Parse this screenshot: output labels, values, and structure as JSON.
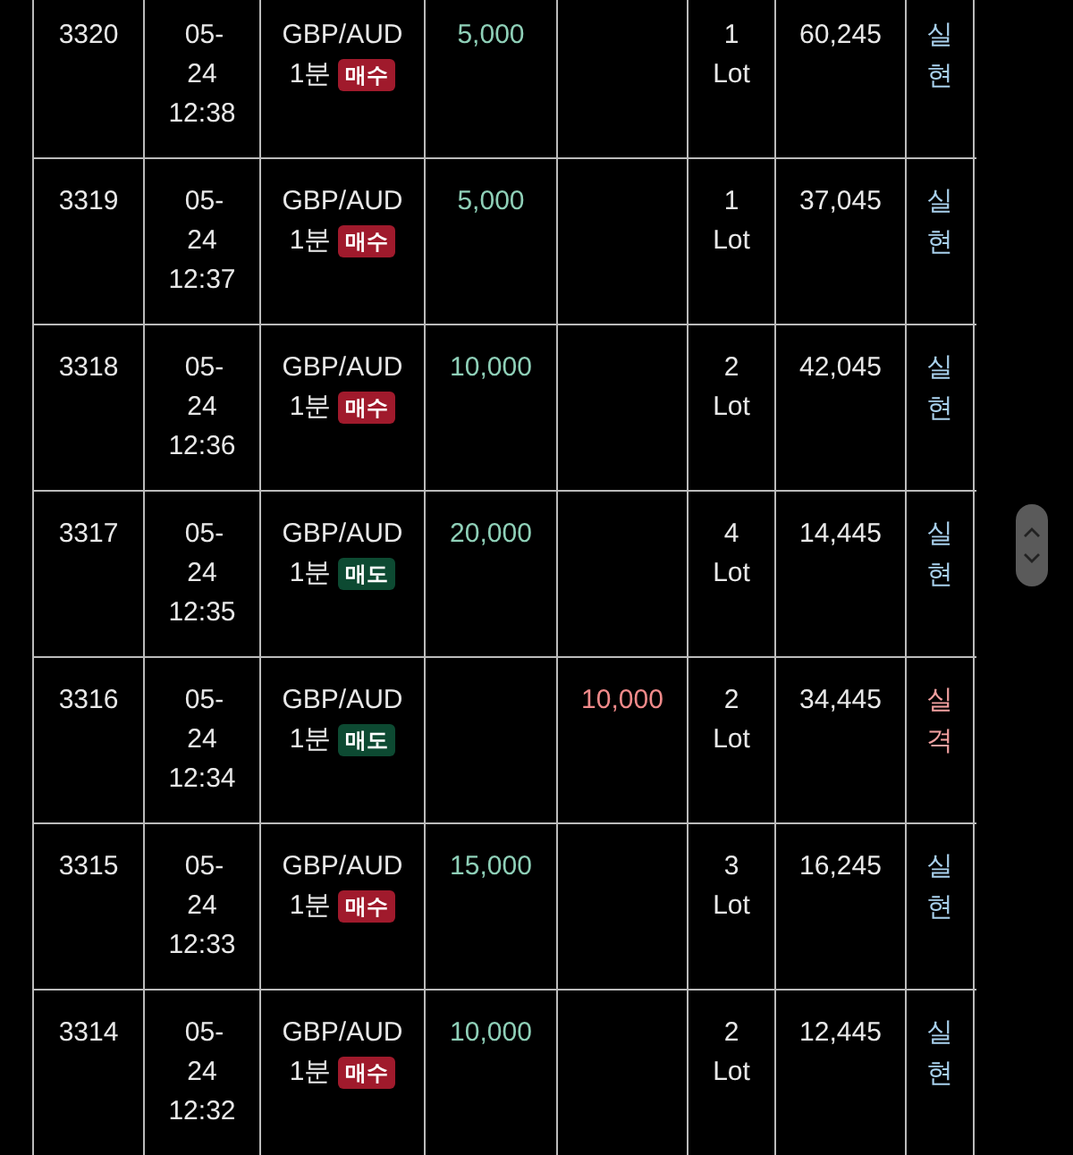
{
  "rows": [
    {
      "id": "3320",
      "date": "05-24",
      "time": "12:38",
      "pair": "GBP/AUD",
      "period": "1분",
      "side": {
        "label": "매수",
        "kind": "buy"
      },
      "profit": "5,000",
      "lot_count": "1",
      "lot_unit": "Lot",
      "balance": "60,245",
      "result": {
        "label": "실현",
        "kind": "realized"
      }
    },
    {
      "id": "3319",
      "date": "05-24",
      "time": "12:37",
      "pair": "GBP/AUD",
      "period": "1분",
      "side": {
        "label": "매수",
        "kind": "buy"
      },
      "profit": "5,000",
      "lot_count": "1",
      "lot_unit": "Lot",
      "balance": "37,045",
      "result": {
        "label": "실현",
        "kind": "realized"
      }
    },
    {
      "id": "3318",
      "date": "05-24",
      "time": "12:36",
      "pair": "GBP/AUD",
      "period": "1분",
      "side": {
        "label": "매수",
        "kind": "buy"
      },
      "profit": "10,000",
      "lot_count": "2",
      "lot_unit": "Lot",
      "balance": "42,045",
      "result": {
        "label": "실현",
        "kind": "realized"
      }
    },
    {
      "id": "3317",
      "date": "05-24",
      "time": "12:35",
      "pair": "GBP/AUD",
      "period": "1분",
      "side": {
        "label": "매도",
        "kind": "sell"
      },
      "profit": "20,000",
      "lot_count": "4",
      "lot_unit": "Lot",
      "balance": "14,445",
      "result": {
        "label": "실현",
        "kind": "realized"
      }
    },
    {
      "id": "3316",
      "date": "05-24",
      "time": "12:34",
      "pair": "GBP/AUD",
      "period": "1분",
      "side": {
        "label": "매도",
        "kind": "sell"
      },
      "loss": "10,000",
      "lot_count": "2",
      "lot_unit": "Lot",
      "balance": "34,445",
      "result": {
        "label": "실격",
        "kind": "failed"
      }
    },
    {
      "id": "3315",
      "date": "05-24",
      "time": "12:33",
      "pair": "GBP/AUD",
      "period": "1분",
      "side": {
        "label": "매수",
        "kind": "buy"
      },
      "profit": "15,000",
      "lot_count": "3",
      "lot_unit": "Lot",
      "balance": "16,245",
      "result": {
        "label": "실현",
        "kind": "realized"
      }
    },
    {
      "id": "3314",
      "date": "05-24",
      "time": "12:32",
      "pair": "GBP/AUD",
      "period": "1분",
      "side": {
        "label": "매수",
        "kind": "buy"
      },
      "profit": "10,000",
      "lot_count": "2",
      "lot_unit": "Lot",
      "balance": "12,445",
      "result": {
        "label": "실현",
        "kind": "realized"
      }
    }
  ]
}
